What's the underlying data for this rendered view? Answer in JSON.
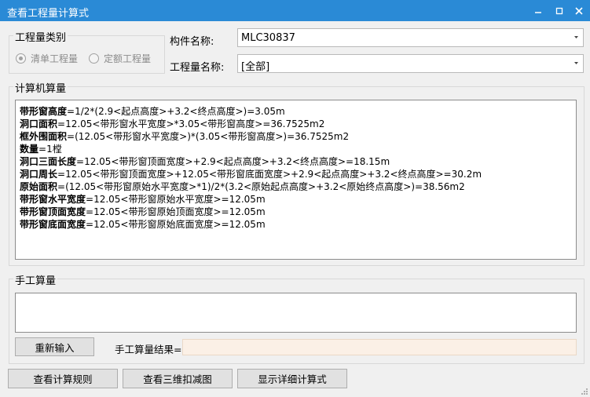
{
  "window": {
    "title": "查看工程量计算式",
    "minimize_symbol": "–",
    "maximize_symbol": "□",
    "close_symbol": "✕"
  },
  "category_group": {
    "legend": "工程量类别",
    "options": [
      {
        "label": "清单工程量",
        "checked": true
      },
      {
        "label": "定额工程量",
        "checked": false
      }
    ]
  },
  "component_name": {
    "label": "构件名称:",
    "value": "MLC30837"
  },
  "quantity_name": {
    "label": "工程量名称:",
    "value": "[全部]"
  },
  "calc_group": {
    "legend": "计算机算量",
    "lines": [
      {
        "name": "带形窗高度",
        "expr": "=1/2*(2.9<起点高度>+3.2<终点高度>)=3.05m"
      },
      {
        "name": "洞口面积",
        "expr": "=12.05<带形窗水平宽度>*3.05<带形窗高度>=36.7525m2"
      },
      {
        "name": "框外围面积",
        "expr": "=(12.05<带形窗水平宽度>)*(3.05<带形窗高度>)=36.7525m2"
      },
      {
        "name": "数量",
        "expr": "=1樘"
      },
      {
        "name": "洞口三面长度",
        "expr": "=12.05<带形窗顶面宽度>+2.9<起点高度>+3.2<终点高度>=18.15m"
      },
      {
        "name": "洞口周长",
        "expr": "=12.05<带形窗顶面宽度>+12.05<带形窗底面宽度>+2.9<起点高度>+3.2<终点高度>=30.2m"
      },
      {
        "name": "原始面积",
        "expr": "=(12.05<带形窗原始水平宽度>*1)/2*(3.2<原始起点高度>+3.2<原始终点高度>)=38.56m2"
      },
      {
        "name": "带形窗水平宽度",
        "expr": "=12.05<带形窗原始水平宽度>=12.05m"
      },
      {
        "name": "带形窗顶面宽度",
        "expr": "=12.05<带形窗原始顶面宽度>=12.05m"
      },
      {
        "name": "带形窗底面宽度",
        "expr": "=12.05<带形窗原始底面宽度>=12.05m"
      }
    ]
  },
  "manual_group": {
    "legend": "手工算量",
    "input_value": "",
    "reenter_label": "重新输入",
    "result_label": "手工算量结果=",
    "result_value": ""
  },
  "footer": {
    "buttons": [
      "查看计算规则",
      "查看三维扣减图",
      "显示详细计算式"
    ]
  },
  "colors": {
    "titlebar": "#2a8ad6",
    "result_bg": "#fbf0e6"
  }
}
